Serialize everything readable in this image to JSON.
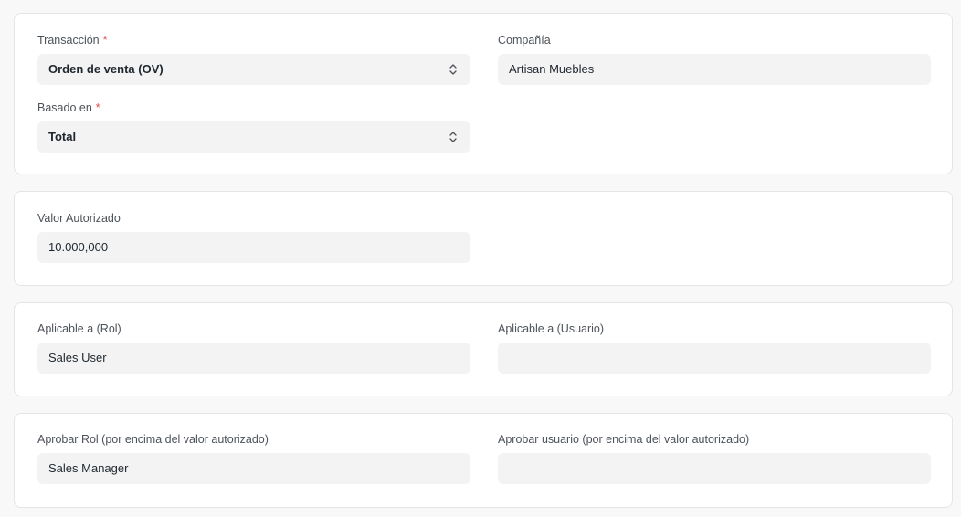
{
  "sections": [
    {
      "fields": {
        "transaction": {
          "label": "Transacción",
          "required_mark": "*",
          "value": "Orden de venta (OV)",
          "icon": "chevron-updown-icon"
        },
        "company": {
          "label": "Compañía",
          "value": "Artisan Muebles"
        },
        "based_on": {
          "label": "Basado en",
          "required_mark": "*",
          "value": "Total",
          "icon": "chevron-updown-icon"
        }
      }
    },
    {
      "fields": {
        "authorized_value": {
          "label": "Valor Autorizado",
          "value": "10.000,000"
        }
      }
    },
    {
      "fields": {
        "applicable_role": {
          "label": "Aplicable a (Rol)",
          "value": "Sales User"
        },
        "applicable_user": {
          "label": "Aplicable a (Usuario)",
          "value": ""
        }
      }
    },
    {
      "fields": {
        "approving_role": {
          "label": "Aprobar Rol (por encima del valor autorizado)",
          "value": "Sales Manager"
        },
        "approving_user": {
          "label": "Aprobar usuario (por encima del valor autorizado)",
          "value": ""
        }
      }
    }
  ],
  "colors": {
    "page_bg": "#f8f8f8",
    "card_bg": "#ffffff",
    "input_bg": "#f3f3f4",
    "required": "#e24c4c",
    "label": "#4c5258",
    "text": "#1f272e"
  }
}
